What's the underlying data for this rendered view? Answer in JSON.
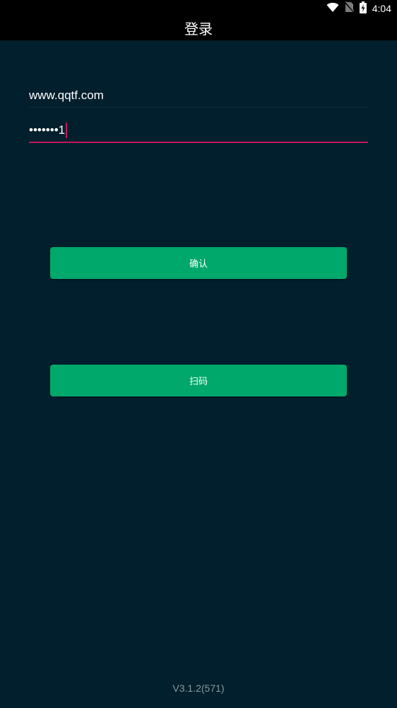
{
  "status_bar": {
    "time": "4:04",
    "icons": [
      "wifi-icon",
      "no-sim-icon",
      "battery-charging-icon"
    ]
  },
  "title_bar": {
    "title": "登录"
  },
  "form": {
    "username_value": "www.qqtf.com",
    "password_value": "•••••••1"
  },
  "buttons": {
    "confirm_label": "确认",
    "scan_label": "扫码"
  },
  "footer": {
    "version": "V3.1.2(571)"
  },
  "colors": {
    "background": "#011f2c",
    "accent_button": "#00a86b",
    "focus_underline": "#c2185b"
  }
}
